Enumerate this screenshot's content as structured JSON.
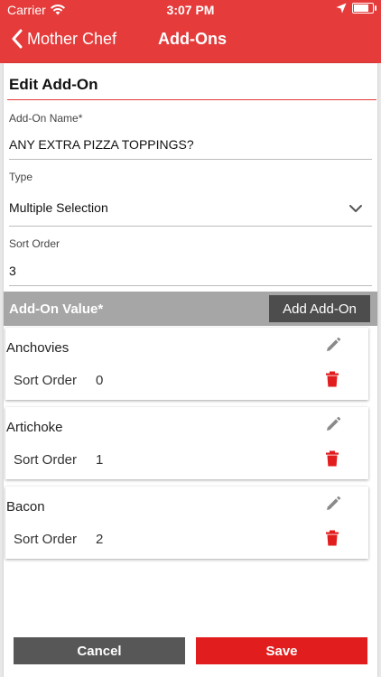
{
  "status": {
    "carrier": "Carrier",
    "time": "3:07 PM"
  },
  "nav": {
    "back_label": "Mother Chef",
    "title": "Add-Ons"
  },
  "form": {
    "title": "Edit Add-On",
    "name_label": "Add-On Name*",
    "name_value": "ANY EXTRA PIZZA TOPPINGS?",
    "type_label": "Type",
    "type_value": "Multiple Selection",
    "sort_label": "Sort Order",
    "sort_value": "3"
  },
  "addon_section": {
    "label": "Add-On Value*",
    "add_button": "Add Add-On"
  },
  "addons": [
    {
      "name": "Anchovies",
      "sort_label": "Sort Order",
      "sort_value": "0"
    },
    {
      "name": "Artichoke",
      "sort_label": "Sort Order",
      "sort_value": "1"
    },
    {
      "name": "Bacon",
      "sort_label": "Sort Order",
      "sort_value": "2"
    }
  ],
  "actions": {
    "cancel": "Cancel",
    "save": "Save"
  },
  "colors": {
    "brand": "#e53b3b",
    "danger": "#e11d1d",
    "dark_button": "#4d4d4d"
  }
}
